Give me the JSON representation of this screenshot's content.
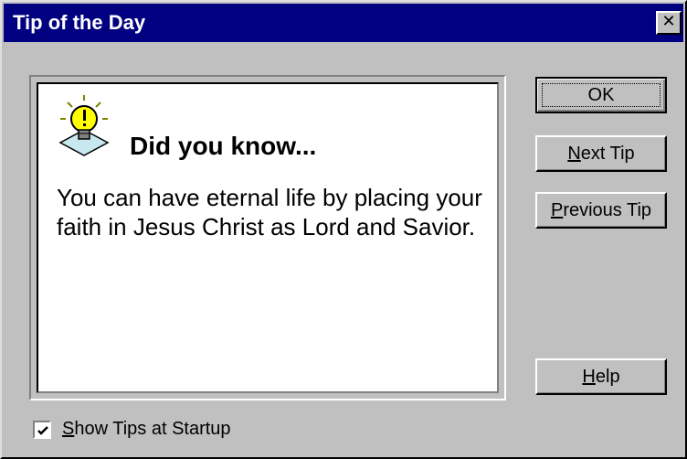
{
  "window": {
    "title": "Tip of the Day",
    "close_glyph": "✕"
  },
  "tip": {
    "icon": "lightbulb-icon",
    "heading": "Did you know...",
    "text": "You can have eternal life by placing your faith in Jesus Christ as Lord and Savior."
  },
  "buttons": {
    "ok": "OK",
    "next": {
      "mnemonic": "N",
      "rest": "ext Tip"
    },
    "previous": {
      "mnemonic": "P",
      "rest": "revious Tip"
    },
    "help": {
      "mnemonic": "H",
      "rest": "elp"
    }
  },
  "startup": {
    "mnemonic": "S",
    "rest": "how Tips at Startup",
    "checked": true
  },
  "colors": {
    "titlebar": "#000080",
    "face": "#c0c0c0",
    "bulb": "#ffff00"
  }
}
